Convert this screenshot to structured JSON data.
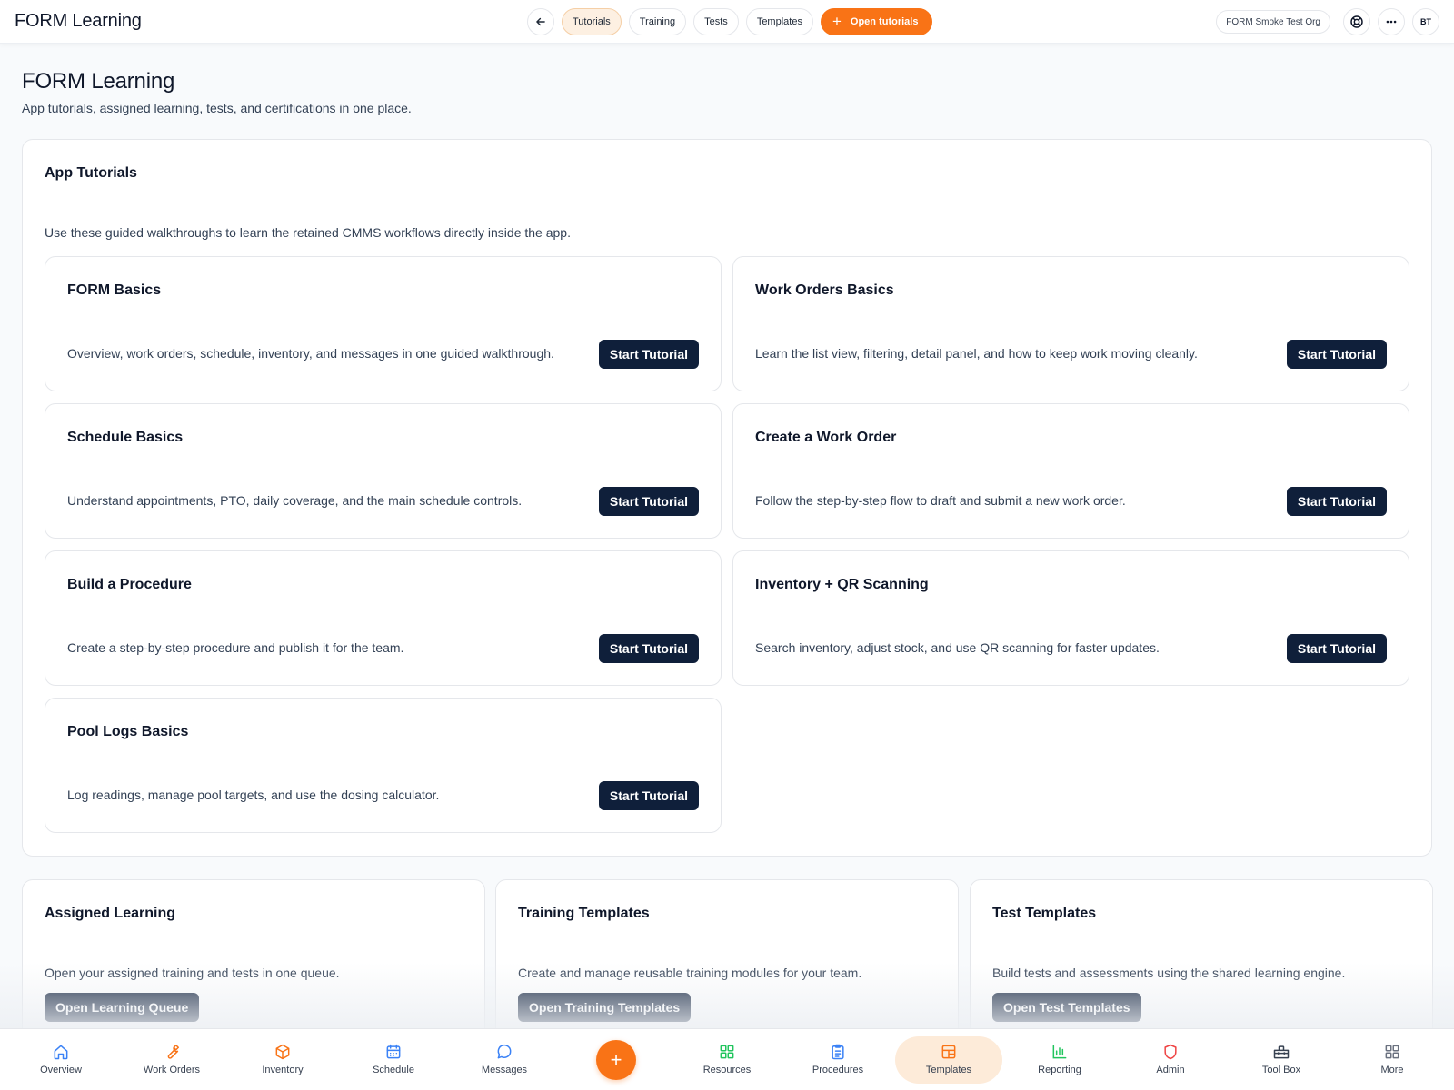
{
  "app": {
    "title": "FORM Learning"
  },
  "topnav": {
    "back_icon": "arrow-left-icon",
    "tabs": [
      {
        "label": "Tutorials",
        "active": true
      },
      {
        "label": "Training",
        "active": false
      },
      {
        "label": "Tests",
        "active": false
      },
      {
        "label": "Templates",
        "active": false
      }
    ],
    "primary_action": {
      "icon": "plus-icon",
      "label": "Open tutorials"
    },
    "org": "FORM Smoke Test Org",
    "help_icon": "lifebuoy-icon",
    "more_icon": "more-horizontal-icon",
    "avatar_initials": "BT"
  },
  "page": {
    "title": "FORM Learning",
    "subtitle": "App tutorials, assigned learning, tests, and certifications in one place."
  },
  "tutorials": {
    "title": "App Tutorials",
    "description": "Use these guided walkthroughs to learn the retained CMMS workflows directly inside the app.",
    "cards": [
      {
        "title": "FORM Basics",
        "description": "Overview, work orders, schedule, inventory, and messages in one guided walkthrough.",
        "button": "Start Tutorial"
      },
      {
        "title": "Work Orders Basics",
        "description": "Learn the list view, filtering, detail panel, and how to keep work moving cleanly.",
        "button": "Start Tutorial"
      },
      {
        "title": "Schedule Basics",
        "description": "Understand appointments, PTO, daily coverage, and the main schedule controls.",
        "button": "Start Tutorial"
      },
      {
        "title": "Create a Work Order",
        "description": "Follow the step-by-step flow to draft and submit a new work order.",
        "button": "Start Tutorial"
      },
      {
        "title": "Build a Procedure",
        "description": "Create a step-by-step procedure and publish it for the team.",
        "button": "Start Tutorial"
      },
      {
        "title": "Inventory + QR Scanning",
        "description": "Search inventory, adjust stock, and use QR scanning for faster updates.",
        "button": "Start Tutorial"
      },
      {
        "title": "Pool Logs Basics",
        "description": "Log readings, manage pool targets, and use the dosing calculator.",
        "button": "Start Tutorial"
      }
    ]
  },
  "sections": [
    {
      "title": "Assigned Learning",
      "description": "Open your assigned training and tests in one queue.",
      "button": "Open Learning Queue"
    },
    {
      "title": "Training Templates",
      "description": "Create and manage reusable training modules for your team.",
      "button": "Open Training Templates"
    },
    {
      "title": "Test Templates",
      "description": "Build tests and assessments using the shared learning engine.",
      "button": "Open Test Templates"
    }
  ],
  "bottomnav": {
    "items": [
      {
        "label": "Overview",
        "icon": "home-icon",
        "color": "#3b82f6"
      },
      {
        "label": "Work Orders",
        "icon": "wrench-icon",
        "color": "#f97316"
      },
      {
        "label": "Inventory",
        "icon": "package-icon",
        "color": "#f97316"
      },
      {
        "label": "Schedule",
        "icon": "calendar-icon",
        "color": "#3b82f6"
      },
      {
        "label": "Messages",
        "icon": "message-circle-icon",
        "color": "#3b82f6"
      },
      {
        "label": "Resources",
        "icon": "grid-icon",
        "color": "#22c55e"
      },
      {
        "label": "Procedures",
        "icon": "clipboard-icon",
        "color": "#3b82f6"
      },
      {
        "label": "Templates",
        "icon": "layout-icon",
        "color": "#f97316",
        "active": true
      },
      {
        "label": "Reporting",
        "icon": "bar-chart-icon",
        "color": "#22c55e"
      },
      {
        "label": "Admin",
        "icon": "shield-icon",
        "color": "#ef4444"
      },
      {
        "label": "Tool Box",
        "icon": "toolbox-icon",
        "color": "#374151"
      },
      {
        "label": "More",
        "icon": "grid-more-icon",
        "color": "#6b7280"
      }
    ],
    "fab_icon": "plus-icon"
  },
  "colors": {
    "accent": "#f97316",
    "dark_button": "#0f1f3a",
    "active_tab_bg": "#fdf0e2"
  }
}
